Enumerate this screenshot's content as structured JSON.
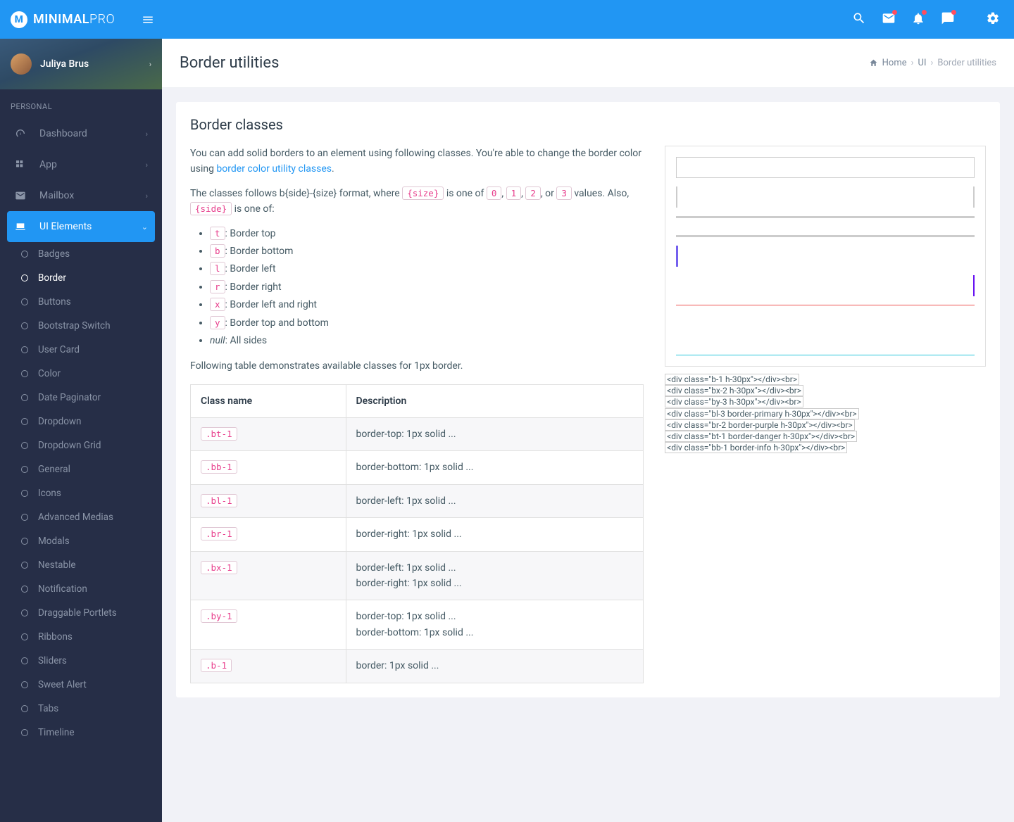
{
  "brand": {
    "main": "MINIMAL",
    "accent": "PRO"
  },
  "user": {
    "name": "Juliya Brus"
  },
  "section_label": "PERSONAL",
  "nav": [
    {
      "key": "dashboard",
      "label": "Dashboard",
      "icon": "gauge",
      "chev": true
    },
    {
      "key": "app",
      "label": "App",
      "icon": "grid",
      "chev": true
    },
    {
      "key": "mailbox",
      "label": "Mailbox",
      "icon": "mail",
      "chev": true
    },
    {
      "key": "ui",
      "label": "UI Elements",
      "icon": "laptop",
      "chev": true,
      "active": true
    }
  ],
  "subnav": [
    {
      "label": "Badges"
    },
    {
      "label": "Border",
      "current": true
    },
    {
      "label": "Buttons"
    },
    {
      "label": "Bootstrap Switch"
    },
    {
      "label": "User Card"
    },
    {
      "label": "Color"
    },
    {
      "label": "Date Paginator"
    },
    {
      "label": "Dropdown"
    },
    {
      "label": "Dropdown Grid"
    },
    {
      "label": "General"
    },
    {
      "label": "Icons"
    },
    {
      "label": "Advanced Medias"
    },
    {
      "label": "Modals"
    },
    {
      "label": "Nestable"
    },
    {
      "label": "Notification"
    },
    {
      "label": "Draggable Portlets"
    },
    {
      "label": "Ribbons"
    },
    {
      "label": "Sliders"
    },
    {
      "label": "Sweet Alert"
    },
    {
      "label": "Tabs"
    },
    {
      "label": "Timeline"
    }
  ],
  "page": {
    "title": "Border utilities",
    "breadcrumb": {
      "home": "Home",
      "mid": "UI",
      "last": "Border utilities"
    }
  },
  "card": {
    "title": "Border classes",
    "intro_a": "You can add solid borders to an element using following classes. You're able to change the border color using ",
    "intro_link": "border color utility classes",
    "intro_b": ".",
    "format_a": "The classes follows b{side}-{size} format, where ",
    "format_mid": " is one of ",
    "format_or": ", or ",
    "format_b": " values. Also, ",
    "format_c": " is one of:",
    "size_code": "{size}",
    "side_code": "{side}",
    "size_vals": [
      "0",
      "1",
      "2",
      "3"
    ],
    "defs": [
      {
        "code": "t",
        "text": ": Border top"
      },
      {
        "code": "b",
        "text": ": Border bottom"
      },
      {
        "code": "l",
        "text": ": Border left"
      },
      {
        "code": "r",
        "text": ": Border right"
      },
      {
        "code": "x",
        "text": ": Border left and right"
      },
      {
        "code": "y",
        "text": ": Border top and bottom"
      }
    ],
    "defs_null_label": "null",
    "defs_null_text": ": All sides",
    "followup": "Following table demonstrates available classes for 1px border.",
    "table": {
      "head": [
        "Class name",
        "Description"
      ],
      "rows": [
        {
          "cls": ".bt-1",
          "desc": [
            "border-top: 1px solid ..."
          ]
        },
        {
          "cls": ".bb-1",
          "desc": [
            "border-bottom: 1px solid ..."
          ]
        },
        {
          "cls": ".bl-1",
          "desc": [
            "border-left: 1px solid ..."
          ]
        },
        {
          "cls": ".br-1",
          "desc": [
            "border-right: 1px solid ..."
          ]
        },
        {
          "cls": ".bx-1",
          "desc": [
            "border-left: 1px solid ...",
            "border-right: 1px solid ..."
          ]
        },
        {
          "cls": ".by-1",
          "desc": [
            "border-top: 1px solid ...",
            "border-bottom: 1px solid ..."
          ]
        },
        {
          "cls": ".b-1",
          "desc": [
            "border: 1px solid ..."
          ]
        }
      ]
    },
    "code_lines": [
      "<div class=\"b-1 h-30px\"></div><br>",
      "<div class=\"bx-2 h-30px\"></div><br>",
      "<div class=\"by-3 h-30px\"></div><br>",
      "<div class=\"bl-3 border-primary h-30px\"></div><br>",
      "<div class=\"br-2 border-purple h-30px\"></div><br>",
      "<div class=\"bt-1 border-danger h-30px\"></div><br>",
      "<div class=\"bb-1 border-info h-30px\"></div><br>"
    ]
  }
}
